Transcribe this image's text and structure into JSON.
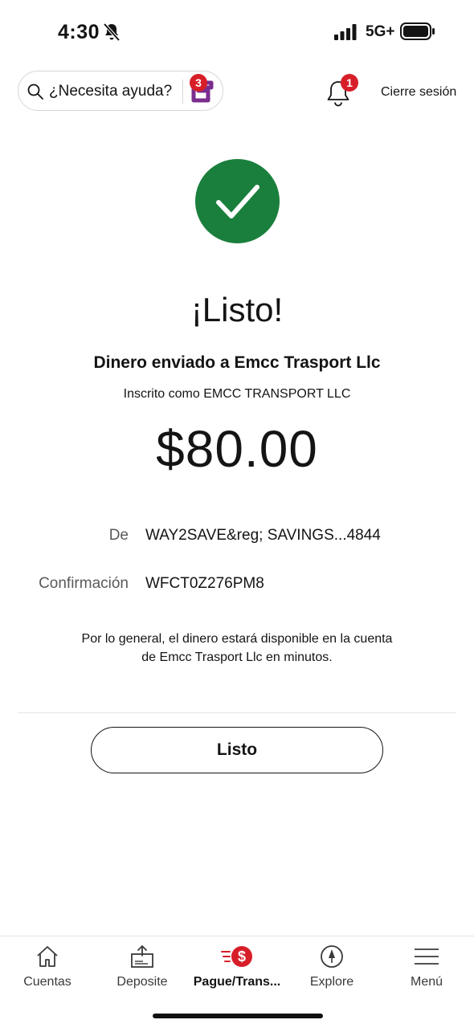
{
  "status_bar": {
    "time": "4:30",
    "network": "5G+",
    "icons": [
      "bell-slash-icon",
      "signal-bars-icon",
      "battery-icon"
    ]
  },
  "header": {
    "search_label": "¿Necesita ayuda?",
    "search_icon": "search-icon",
    "assistant_icon": "fargo-assistant-icon",
    "assistant_badge": "3",
    "notification_icon": "bell-icon",
    "notification_badge": "1",
    "signout_label": "Cierre sesión"
  },
  "confirmation": {
    "icon": "checkmark-icon",
    "title": "¡Listo!",
    "sent_to": "Dinero enviado a Emcc Trasport Llc",
    "enrolled_as": "Inscrito como EMCC TRANSPORT LLC",
    "amount": "$80.00",
    "details": [
      {
        "label": "De",
        "value": "WAY2SAVE&reg; SAVINGS...4844"
      },
      {
        "label": "Confirmación",
        "value": "WFCT0Z276PM8"
      }
    ],
    "note": "Por lo general, el dinero estará disponible en la cuenta de Emcc Trasport Llc en minutos.",
    "done_button": "Listo"
  },
  "bottom_nav": {
    "items": [
      {
        "label": "Cuentas",
        "icon": "home-icon"
      },
      {
        "label": "Deposite",
        "icon": "deposit-icon"
      },
      {
        "label": "Pague/Trans...",
        "icon": "pay-transfer-icon",
        "active": true
      },
      {
        "label": "Explore",
        "icon": "compass-icon"
      },
      {
        "label": "Menú",
        "icon": "hamburger-menu-icon"
      }
    ]
  },
  "colors": {
    "success_green": "#1a7f3c",
    "badge_red": "#d71e28",
    "assistant_purple": "#7b2d8e",
    "text": "#141414"
  }
}
